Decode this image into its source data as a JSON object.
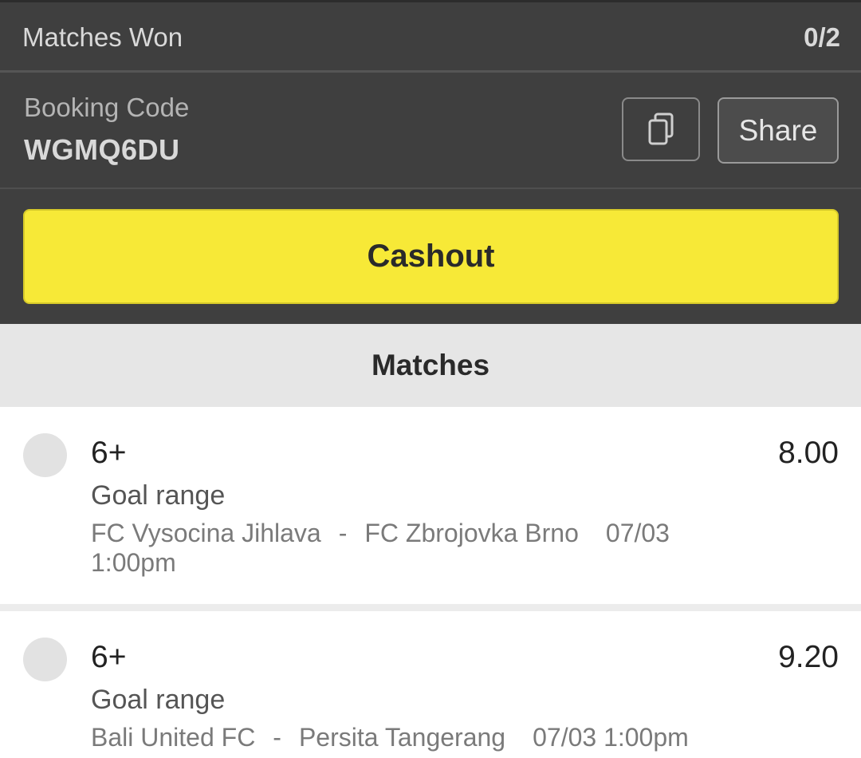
{
  "summary": {
    "matches_won_label": "Matches Won",
    "matches_won_value": "0/2"
  },
  "booking": {
    "label": "Booking Code",
    "code": "WGMQ6DU",
    "copy_icon": "copy-icon",
    "share_label": "Share"
  },
  "cashout": {
    "label": "Cashout",
    "color": "#f7e937"
  },
  "matches_section": {
    "title": "Matches"
  },
  "matches": [
    {
      "pick": "6+",
      "market": "Goal range",
      "home": "FC Vysocina Jihlava",
      "separator": "-",
      "away": "FC Zbrojovka Brno",
      "datetime": "07/03 1:00pm",
      "odds": "8.00"
    },
    {
      "pick": "6+",
      "market": "Goal range",
      "home": "Bali United FC",
      "separator": "-",
      "away": "Persita Tangerang",
      "datetime": "07/03 1:00pm",
      "odds": "9.20"
    }
  ]
}
